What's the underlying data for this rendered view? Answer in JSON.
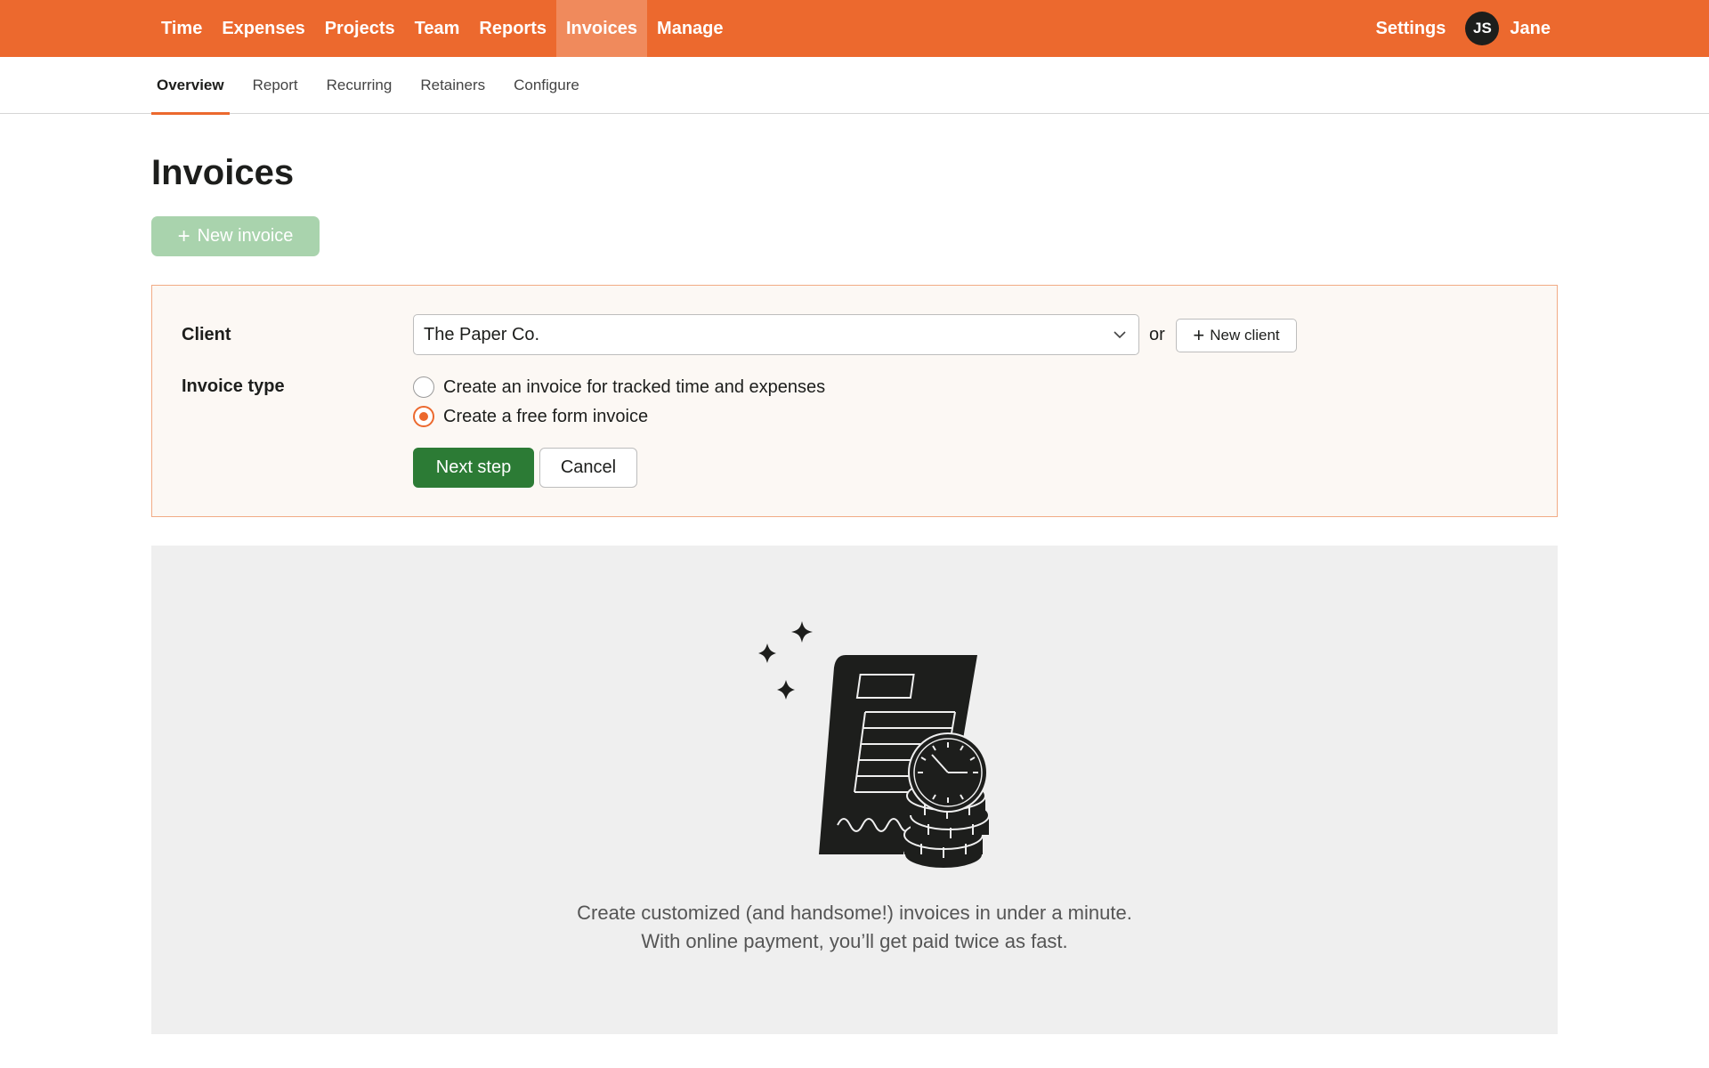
{
  "topnav": {
    "items": [
      {
        "label": "Time"
      },
      {
        "label": "Expenses"
      },
      {
        "label": "Projects"
      },
      {
        "label": "Team"
      },
      {
        "label": "Reports"
      },
      {
        "label": "Invoices",
        "active": true
      },
      {
        "label": "Manage"
      }
    ],
    "settings_label": "Settings",
    "user": {
      "initials": "JS",
      "name": "Jane"
    }
  },
  "subnav": {
    "tabs": [
      {
        "label": "Overview",
        "active": true
      },
      {
        "label": "Report"
      },
      {
        "label": "Recurring"
      },
      {
        "label": "Retainers"
      },
      {
        "label": "Configure"
      }
    ]
  },
  "page": {
    "title": "Invoices",
    "new_invoice_label": "New invoice"
  },
  "form": {
    "client_label": "Client",
    "client_value": "The Paper Co.",
    "or_text": "or",
    "new_client_label": "New client",
    "invoice_type_label": "Invoice type",
    "options": [
      {
        "label": "Create an invoice for tracked time and expenses",
        "checked": false
      },
      {
        "label": "Create a free form invoice",
        "checked": true
      }
    ],
    "next_label": "Next step",
    "cancel_label": "Cancel"
  },
  "empty_state": {
    "line1": "Create customized (and handsome!) invoices in under a minute.",
    "line2": "With online payment, you’ll get paid twice as fast."
  },
  "colors": {
    "brand": "#ec692e",
    "primary_button": "#2c7b35",
    "disabled_button": "#a9d3ad"
  }
}
